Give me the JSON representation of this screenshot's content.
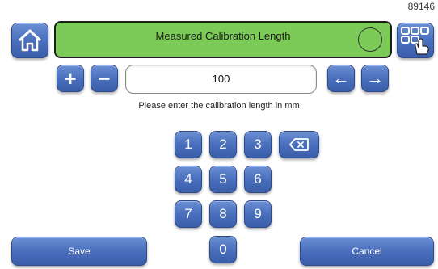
{
  "corner_id": "89146",
  "header": {
    "title": "Measured Calibration Length",
    "status_color": "#7ccb58"
  },
  "value_field": {
    "value": "100"
  },
  "hint": "Please enter the calibration length in mm",
  "controls": {
    "plus": "+",
    "minus": "−",
    "arrow_left": "←",
    "arrow_right": "→"
  },
  "keypad": {
    "k1": "1",
    "k2": "2",
    "k3": "3",
    "k4": "4",
    "k5": "5",
    "k6": "6",
    "k7": "7",
    "k8": "8",
    "k9": "9",
    "k0": "0"
  },
  "footer": {
    "save_label": "Save",
    "cancel_label": "Cancel"
  },
  "icons": {
    "home": "home-icon",
    "grid": "grid-hand-icon",
    "backspace": "backspace-icon"
  },
  "colors": {
    "button": "#4a6fbd",
    "title_bar": "#7ccb58"
  }
}
